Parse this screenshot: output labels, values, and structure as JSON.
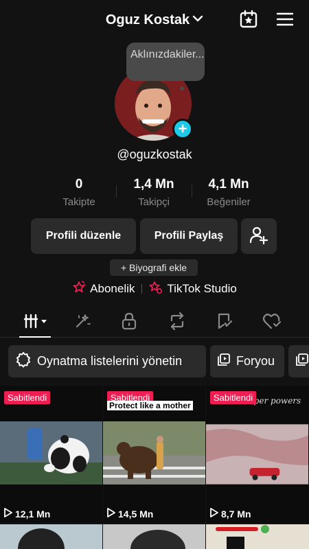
{
  "header": {
    "username": "Oguz Kostak",
    "username_icon": "chevron-down-icon",
    "calendar_icon": "calendar-star-icon",
    "menu_icon": "hamburger-menu-icon"
  },
  "profile": {
    "tooltip": "Aklınızdakiler...",
    "handle": "@oguzkostak",
    "add_icon": "plus-icon"
  },
  "stats": [
    {
      "value": "0",
      "label": "Takipte"
    },
    {
      "value": "1,4 Mn",
      "label": "Takipçi"
    },
    {
      "value": "4,1 Mn",
      "label": "Beğeniler"
    }
  ],
  "buttons": {
    "edit_profile": "Profili düzenle",
    "share_profile": "Profili Paylaş",
    "add_friend_icon": "add-user-icon"
  },
  "bio": {
    "add_label": "+ Biyografi ekle"
  },
  "links": {
    "subscription": "Abonelik",
    "studio": "TikTok Studio"
  },
  "tabs": [
    {
      "icon": "grid-icon",
      "active": true
    },
    {
      "icon": "magic-wand-icon"
    },
    {
      "icon": "lock-icon"
    },
    {
      "icon": "repost-icon"
    },
    {
      "icon": "bookmark-icon"
    },
    {
      "icon": "liked-heart-icon"
    }
  ],
  "chips": {
    "manage_playlists": "Oynatma listelerini yönetin",
    "foryou": "Foryou"
  },
  "videos": [
    {
      "pinned": "Sabitlendi",
      "caption": "",
      "views": "12,1 Mn"
    },
    {
      "pinned": "Sabitlendi",
      "caption": "Protect like a mother",
      "views": "14,5 Mn"
    },
    {
      "pinned": "Sabitlendi",
      "caption": "super powers",
      "views": "8,7 Mn"
    }
  ],
  "colors": {
    "background": "#121212",
    "button": "#2b2b2b",
    "accent_cyan": "#1fc8e6",
    "accent_pink": "#ee1d52"
  }
}
